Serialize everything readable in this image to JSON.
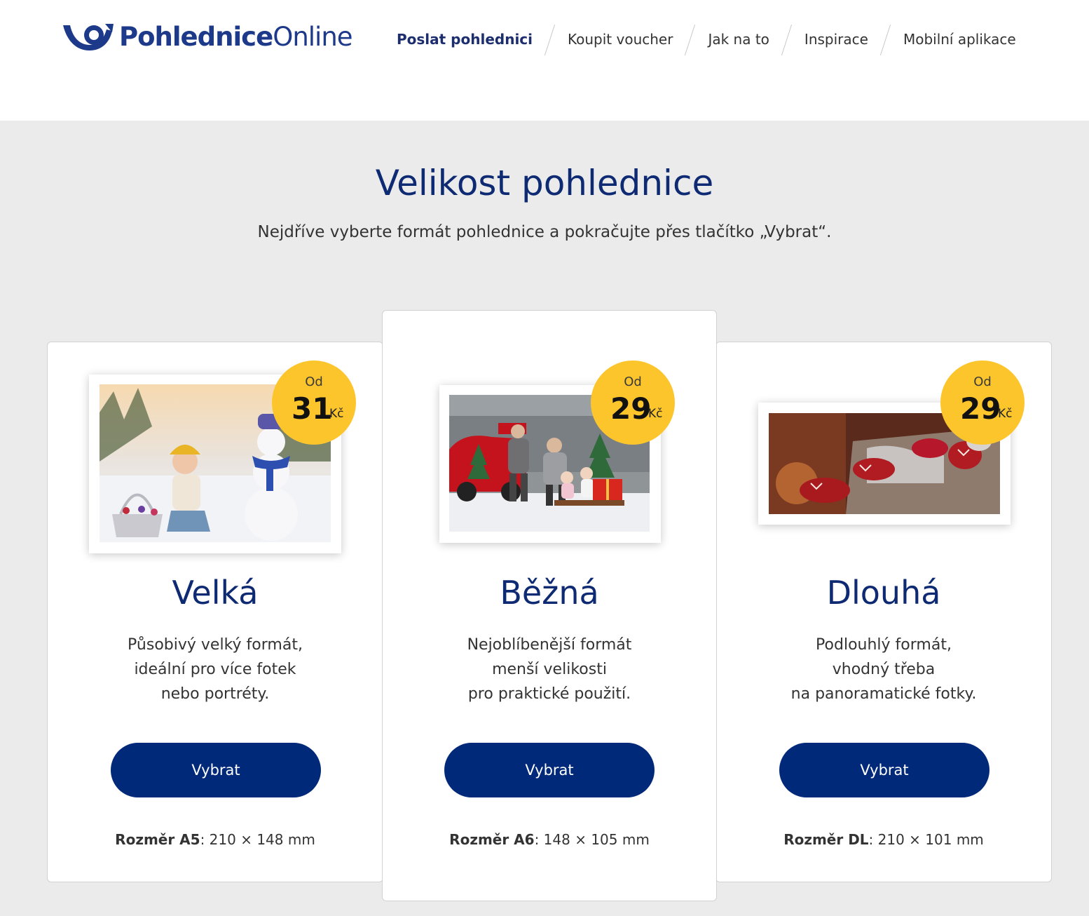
{
  "logo": {
    "bold": "Pohlednice",
    "light": "Online"
  },
  "nav": [
    {
      "label": "Poslat pohlednici",
      "active": true
    },
    {
      "label": "Koupit voucher"
    },
    {
      "label": "Jak na to"
    },
    {
      "label": "Inspirace"
    },
    {
      "label": "Mobilní aplikace"
    }
  ],
  "page": {
    "title": "Velikost pohlednice",
    "subtitle": "Nejdříve vyberte formát pohlednice a pokračujte přes tlačítko „Vybrat“."
  },
  "cards": [
    {
      "title": "Velká",
      "desc": [
        "Působivý velký formát,",
        "ideální pro více fotek",
        "nebo portréty."
      ],
      "badge": {
        "od": "Od",
        "price": "31",
        "currency": "Kč"
      },
      "button": "Vybrat",
      "dim_label": "Rozměr A5",
      "dim_value": ": 210 × 148 mm",
      "photo": "snowman-winter-photo"
    },
    {
      "title": "Běžná",
      "desc": [
        "Nejoblíbenější formát",
        "menší velikosti",
        "pro praktické použití."
      ],
      "badge": {
        "od": "Od",
        "price": "29",
        "currency": "Kč"
      },
      "button": "Vybrat",
      "dim_label": "Rozměr A6",
      "dim_value": ": 148 × 105 mm",
      "photo": "family-sled-christmas-photo"
    },
    {
      "title": "Dlouhá",
      "desc": [
        "Podlouhlý formát,",
        "vhodný třeba",
        "na panoramatické fotky."
      ],
      "badge": {
        "od": "Od",
        "price": "29",
        "currency": "Kč"
      },
      "button": "Vybrat",
      "dim_label": "Rozměr DL",
      "dim_value": ": 210 × 101 mm",
      "photo": "christmas-socks-fireplace-photo"
    }
  ],
  "colors": {
    "brand": "#0e2a73",
    "button": "#01297a",
    "badge": "#fdc52c",
    "background": "#ebebeb"
  }
}
